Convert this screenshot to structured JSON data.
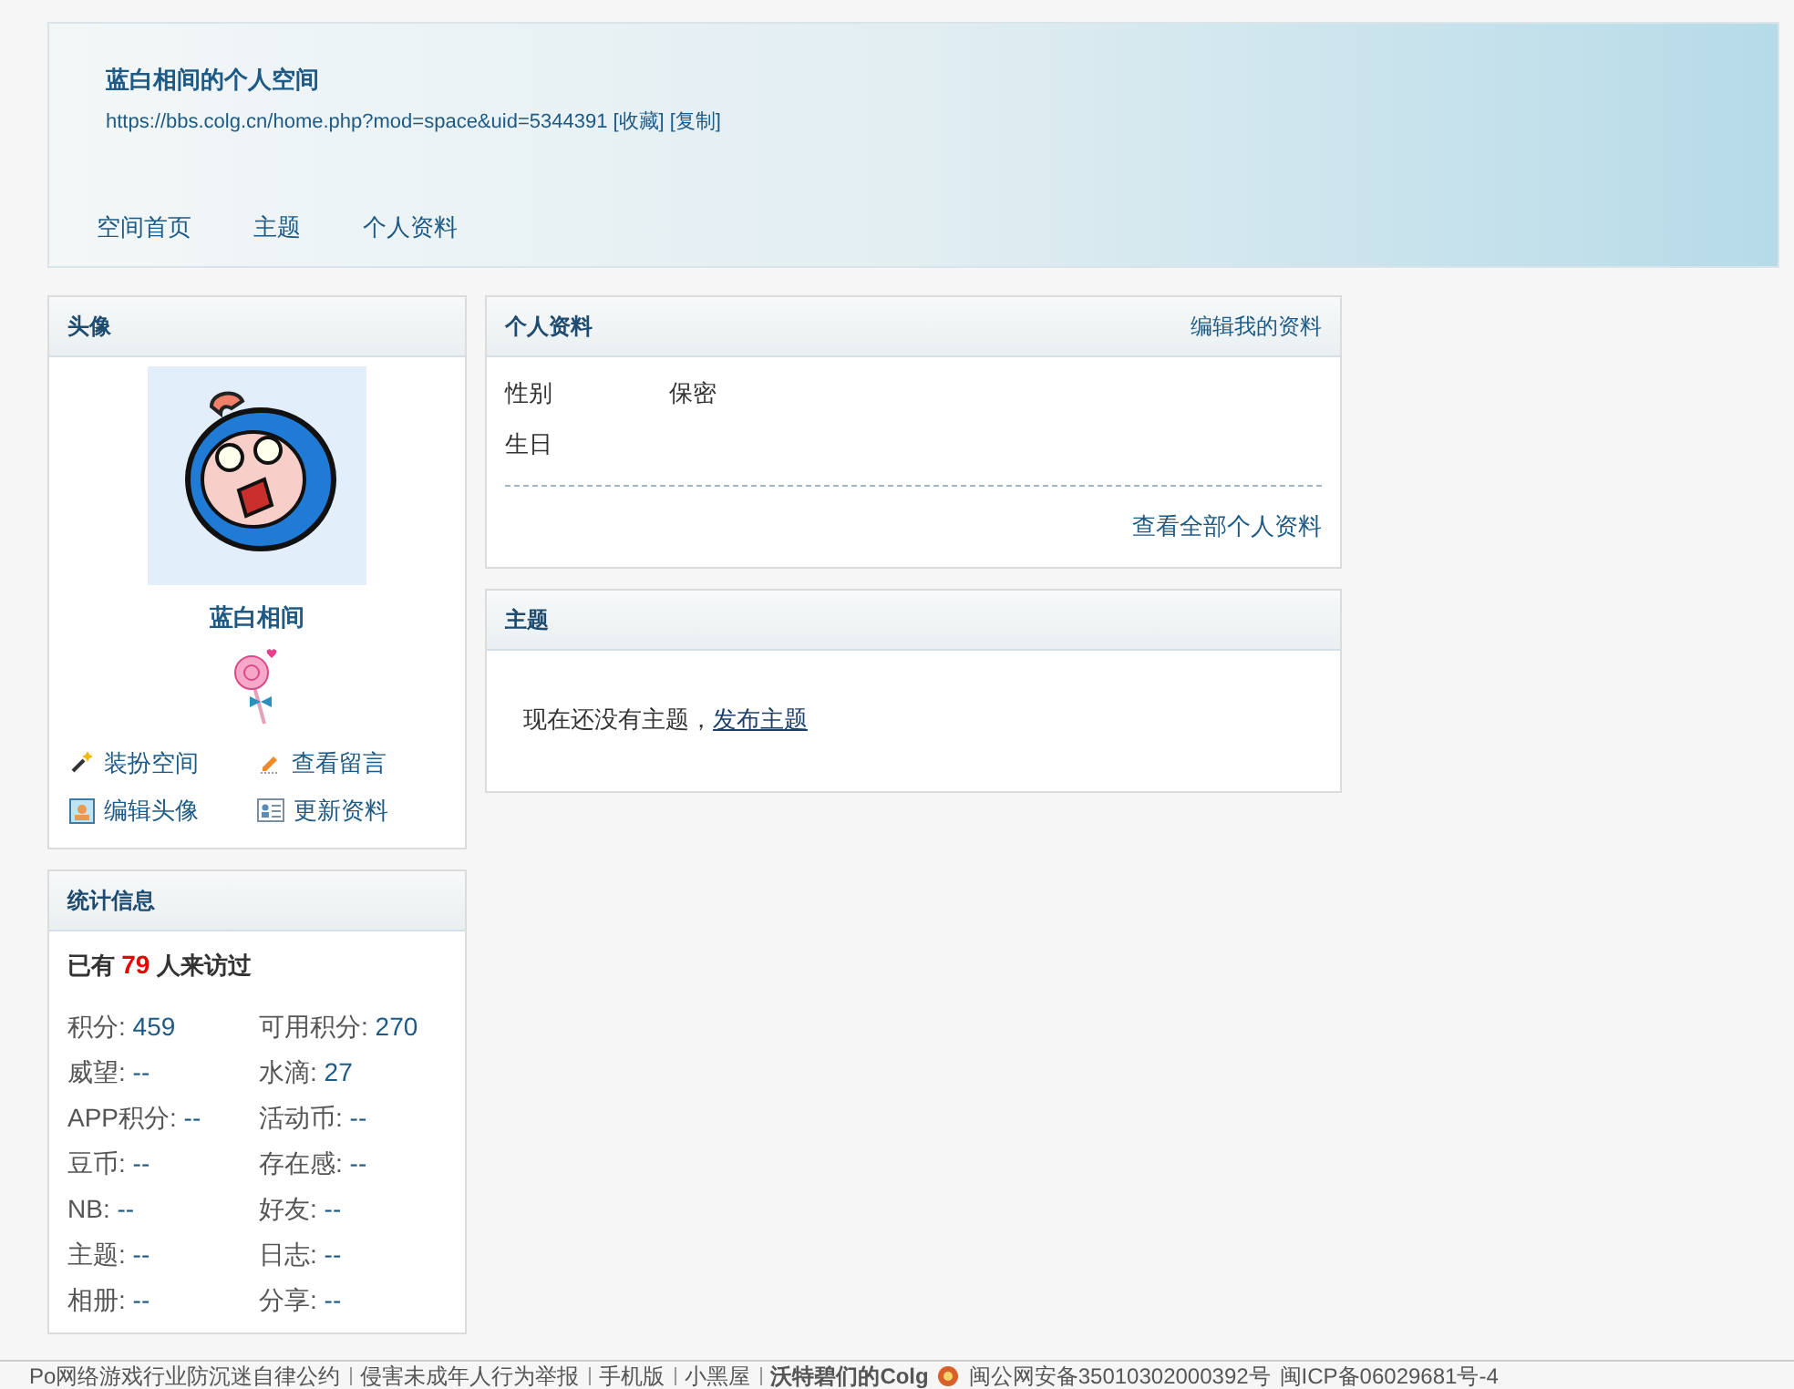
{
  "header": {
    "title": "蓝白相间的个人空间",
    "url": "https://bbs.colg.cn/home.php?mod=space&uid=5344391",
    "actions": [
      "[收藏]",
      "[复制]"
    ],
    "nav": [
      {
        "label": "空间首页"
      },
      {
        "label": "主题"
      },
      {
        "label": "个人资料"
      }
    ]
  },
  "avatar_panel": {
    "title": "头像",
    "username": "蓝白相间",
    "links": [
      {
        "kind": "wand",
        "label": "装扮空间"
      },
      {
        "kind": "pencil",
        "label": "查看留言"
      },
      {
        "kind": "picture",
        "label": "编辑头像"
      },
      {
        "kind": "card",
        "label": "更新资料"
      }
    ]
  },
  "stats_panel": {
    "title": "统计信息",
    "visitors_prefix": "已有",
    "visitors_count": "79",
    "visitors_suffix": "人来访过",
    "items": [
      "积分: 459",
      "可用积分: 270",
      "威望: --",
      "水滴: 27",
      "APP积分: --",
      "活动币: --",
      "豆币: --",
      "存在感: --",
      "NB: --",
      "好友: --",
      "主题: --",
      "日志: --",
      "相册: --",
      "分享: --"
    ]
  },
  "profile_panel": {
    "title": "个人资料",
    "edit_link": "编辑我的资料",
    "fields": [
      {
        "label": "性别",
        "value": "保密"
      },
      {
        "label": "生日"
      }
    ],
    "view_all": "查看全部个人资料"
  },
  "threads_panel": {
    "title": "主题",
    "empty_text": "现在还没有主题，",
    "post_link": "发布主题"
  },
  "footer": {
    "links": [
      "Po网络游戏行业防沉迷自律公约",
      "侵害未成年人行为举报",
      "手机版",
      "小黑屋"
    ],
    "site_name": "沃特碧们的Colg",
    "police_record": "闽公网安备35010302000392号",
    "icp": "闽ICP备06029681号-4"
  }
}
